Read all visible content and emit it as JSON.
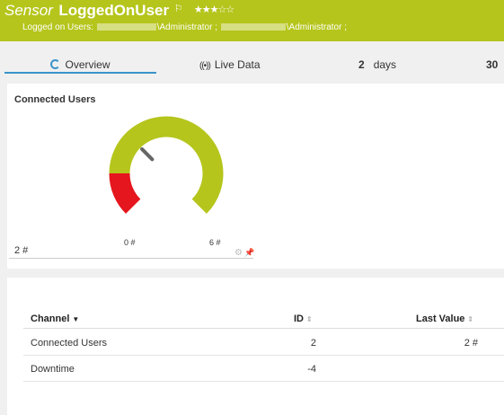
{
  "header": {
    "prefix": "Sensor",
    "name": "LoggedOnUser",
    "flag_icon": "flag-icon",
    "stars": "★★★☆☆",
    "logged_label": "Logged on Users:",
    "user1_suffix": "\\Administrator ;",
    "user2_suffix": "\\Administrator ;",
    "background": "#b5c51c"
  },
  "tabs": {
    "overview": "Overview",
    "live_data": "Live Data",
    "days_value": "2",
    "days_label": "days",
    "thirty": "30"
  },
  "gauge": {
    "title": "Connected Users",
    "current": "2 #",
    "min_label": "0 #",
    "max_label": "6 #",
    "min": 0,
    "max": 6,
    "value": 2,
    "red_until": 1,
    "colors": {
      "red": "#e5161d",
      "green": "#b5c51c",
      "needle": "#666666"
    }
  },
  "table": {
    "headers": {
      "channel": "Channel",
      "id": "ID",
      "last_value": "Last Value"
    },
    "rows": [
      {
        "channel": "Connected Users",
        "id": "2",
        "last_value": "2 #"
      },
      {
        "channel": "Downtime",
        "id": "-4",
        "last_value": ""
      }
    ]
  }
}
